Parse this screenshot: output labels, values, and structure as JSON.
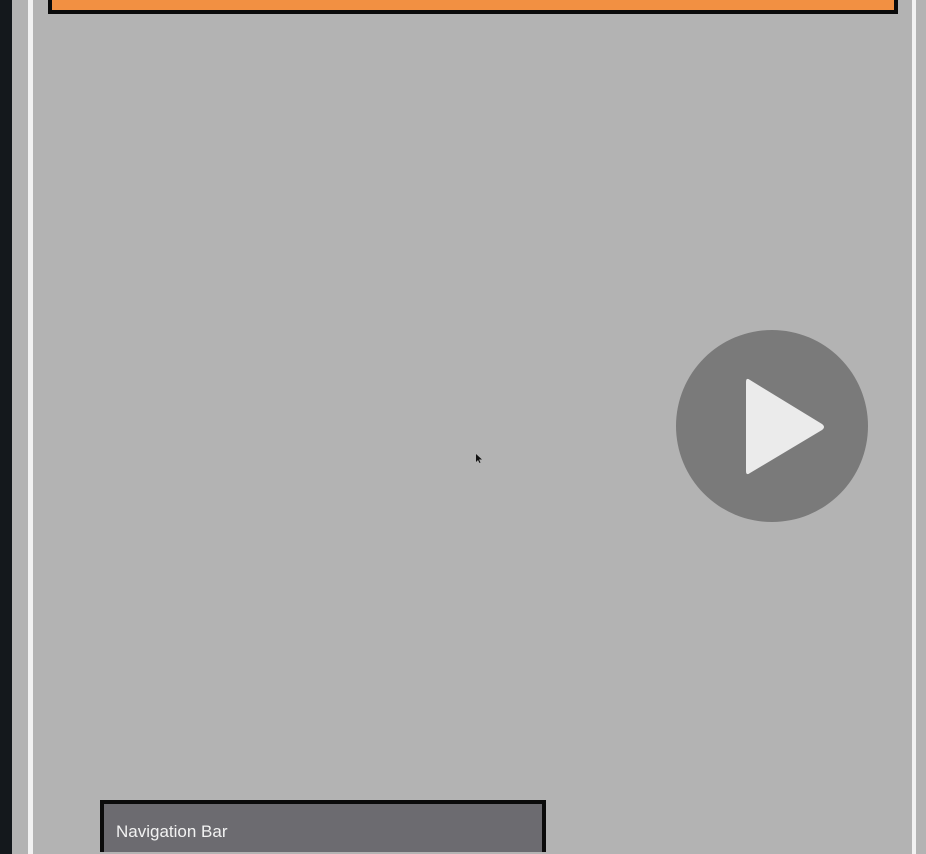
{
  "nav_bar": {
    "label": "Navigation Bar"
  },
  "icons": {
    "play": "play-icon",
    "cursor": "mouse-cursor-icon"
  },
  "colors": {
    "background": "#b3b3b3",
    "top_banner": "#f29042",
    "play_button": "#7a7a7a",
    "play_glyph": "#ebebeb",
    "nav_bar": "#6c6b70",
    "border": "#0b0b0b",
    "frame_line": "#f2f2f2"
  }
}
